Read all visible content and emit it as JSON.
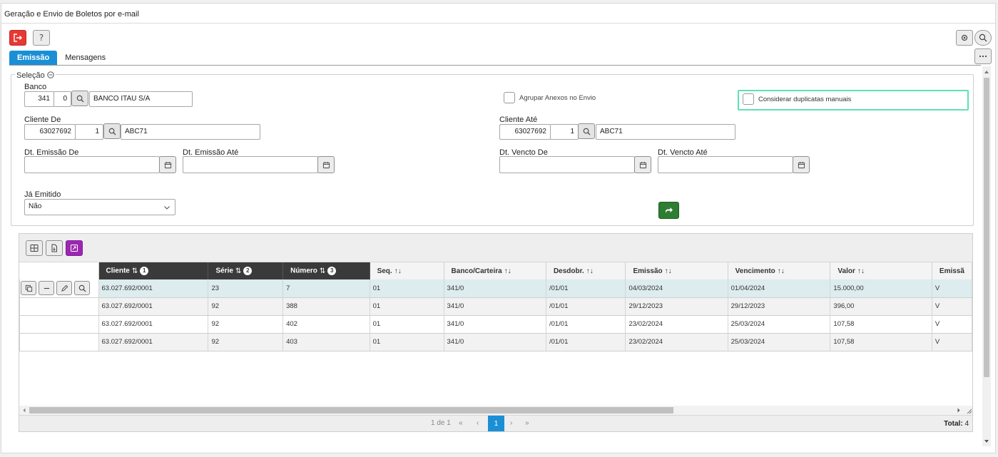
{
  "window": {
    "title": "Geração e Envio de Boletos por e-mail"
  },
  "tabs": [
    {
      "label": "Emissão"
    },
    {
      "label": "Mensagens"
    }
  ],
  "selection": {
    "legend": "Seleção",
    "banco": {
      "label": "Banco",
      "code": "341",
      "agency": "0",
      "name": "BANCO ITAU S/A"
    },
    "agrupar_anexos": {
      "label": "Agrupar Anexos no Envio",
      "checked": false
    },
    "considerar_duplicatas": {
      "label": "Considerar duplicatas manuais",
      "checked": false
    },
    "cliente_de": {
      "label": "Cliente De",
      "code": "63027692",
      "seq": "1",
      "name": "ABC71"
    },
    "cliente_ate": {
      "label": "Cliente Até",
      "code": "63027692",
      "seq": "1",
      "name": "ABC71"
    },
    "dt_emissao_de": {
      "label": "Dt. Emissão De",
      "value": ""
    },
    "dt_emissao_ate": {
      "label": "Dt. Emissão Até",
      "value": ""
    },
    "dt_vencto_de": {
      "label": "Dt. Vencto De",
      "value": ""
    },
    "dt_vencto_ate": {
      "label": "Dt. Vencto Até",
      "value": ""
    },
    "ja_emitido": {
      "label": "Já Emitido",
      "value": "Não"
    }
  },
  "grid": {
    "columns": [
      {
        "label": "Cliente",
        "sort": "1"
      },
      {
        "label": "Série",
        "sort": "2"
      },
      {
        "label": "Número",
        "sort": "3"
      },
      {
        "label": "Seq."
      },
      {
        "label": "Banco/Carteira"
      },
      {
        "label": "Desdobr."
      },
      {
        "label": "Emissão"
      },
      {
        "label": "Vencimento"
      },
      {
        "label": "Valor"
      },
      {
        "label": "Emissã"
      }
    ],
    "rows": [
      [
        "63.027.692/0001",
        "23",
        "7",
        "01",
        "341/0",
        "/01/01",
        "04/03/2024",
        "01/04/2024",
        "15.000,00",
        "V"
      ],
      [
        "63.027.692/0001",
        "92",
        "388",
        "01",
        "341/0",
        "/01/01",
        "29/12/2023",
        "29/12/2023",
        "396,00",
        "V"
      ],
      [
        "63.027.692/0001",
        "92",
        "402",
        "01",
        "341/0",
        "/01/01",
        "23/02/2024",
        "25/03/2024",
        "107,58",
        "V"
      ],
      [
        "63.027.692/0001",
        "92",
        "403",
        "01",
        "341/0",
        "/01/01",
        "23/02/2024",
        "25/03/2024",
        "107,58",
        "V"
      ]
    ],
    "pager": {
      "info": "1 de 1",
      "current": "1",
      "total_label": "Total:",
      "total": "4"
    }
  }
}
